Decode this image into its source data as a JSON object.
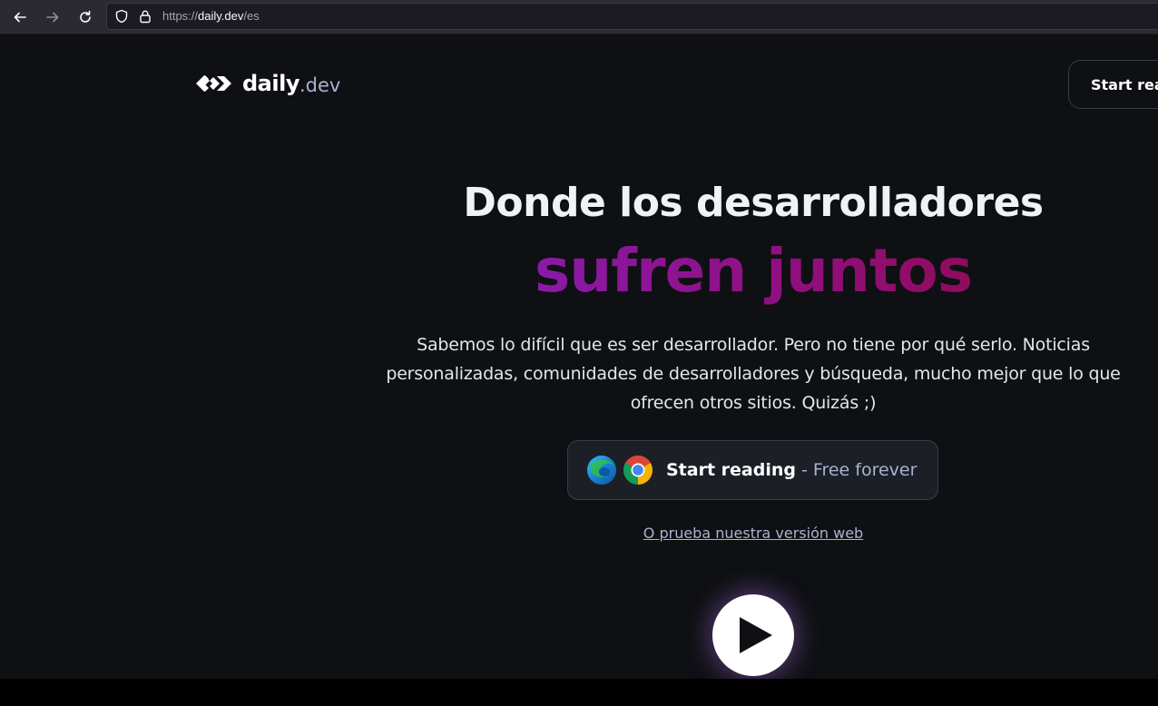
{
  "browser": {
    "url_scheme": "https://",
    "url_host": "daily.dev",
    "url_path": "/es",
    "back_icon": "arrow-left-icon",
    "forward_icon": "arrow-right-icon",
    "reload_icon": "reload-icon",
    "shield_icon": "shield-icon",
    "lock_icon": "lock-icon"
  },
  "header": {
    "logo_word": "daily",
    "logo_suffix": ".dev",
    "cta_label": "Start rea"
  },
  "hero": {
    "title": "Donde los desarrolladores",
    "highlight": "sufren juntos",
    "description": "Sabemos lo difícil que es ser desarrollador. Pero no tiene por qué serlo. Noticias personalizadas, comunidades de desarrolladores y búsqueda, mucho mejor que lo que ofrecen otros sitios. Quizás ;)",
    "cta_strong": "Start reading",
    "cta_muted": " - Free forever",
    "web_link": "O prueba nuestra versión web"
  },
  "colors": {
    "background": "#0e1013",
    "highlight_start": "#8a1aa8",
    "highlight_end": "#8f0c5c",
    "muted_text": "#a8b3cf"
  },
  "icons": {
    "edge": "edge-browser-icon",
    "chrome": "chrome-browser-icon",
    "play": "play-icon"
  }
}
